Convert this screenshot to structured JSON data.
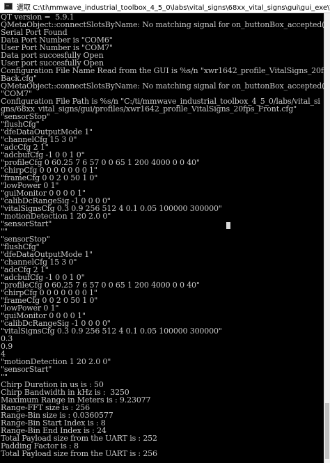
{
  "window": {
    "title": "選取 C:\\ti\\mmwave_industrial_toolbox_4_5_0\\labs\\vital_signs\\68xx_vital_signs\\gui\\gui_exe\\V..."
  },
  "console": {
    "lines": [
      "QT version =  5.9.1",
      "QMetaObject::connectSlotsByName: No matching signal for on_buttonBox_accepted()",
      "Serial Port Found",
      "Data Port Number is \"COM6\"",
      "User Port Number is \"COM7\"",
      "Data port succesfully Open",
      "User port succesfully Open",
      "Configuration File Name Read from the GUI is %s/n \"xwr1642_profile_VitalSigns_20fps_",
      "Back.cfg\"",
      "QMetaObject::connectSlotsByName: No matching signal for on_buttonBox_accepted()",
      "\"COM7\"",
      "Configuration File Path is %s/n \"C:/ti/mmwave_industrial_toolbox_4_5_0/labs/vital_si",
      "gns/68xx_vital_signs/gui/profiles/xwr1642_profile_VitalSigns_20fps_Front.cfg\"",
      "\"sensorStop\"",
      "\"flushCfg\"",
      "\"dfeDataOutputMode 1\"",
      "\"channelCfg 15 3 0\"",
      "\"adcCfg 2 1\"",
      "\"adcbufCfg -1 0 0 1 0\"",
      "\"profileCfg 0 60.25 7 6 57 0 0 65 1 200 4000 0 0 40\"",
      "\"chirpCfg 0 0 0 0 0 0 0 1\"",
      "\"frameCfg 0 0 2 0 50 1 0\"",
      "\"lowPower 0 1\"",
      "\"guiMonitor 0 0 0 0 1\"",
      "\"calibDcRangeSig -1 0 0 0 0\"",
      "\"vitalSignsCfg 0.3 0.9 256 512 4 0.1 0.05 100000 300000\"",
      "\"motionDetection 1 20 2.0 0\"",
      "\"sensorStart\"",
      "\"\"",
      "\"sensorStop\"",
      "\"flushCfg\"",
      "\"dfeDataOutputMode 1\"",
      "\"channelCfg 15 3 0\"",
      "\"adcCfg 2 1\"",
      "\"adcbufCfg -1 0 0 1 0\"",
      "\"profileCfg 0 60.25 7 6 57 0 0 65 1 200 4000 0 0 40\"",
      "\"chirpCfg 0 0 0 0 0 0 0 1\"",
      "\"frameCfg 0 0 2 0 50 1 0\"",
      "\"lowPower 0 1\"",
      "\"guiMonitor 0 0 0 0 1\"",
      "\"calibDcRangeSig -1 0 0 0 0\"",
      "\"vitalSignsCfg 0.3 0.9 256 512 4 0.1 0.05 100000 300000\"",
      "0.3",
      "0.9",
      "4",
      "\"motionDetection 1 20 2.0 0\"",
      "\"sensorStart\"",
      "\"\"",
      "Chirp Duration in us is : 50",
      "Chirp Bandwidth in kHz is :  3250",
      "Maximum Range in Meters is : 9.23077",
      "Range-FFT size is : 256",
      "Range-Bin size is : 0.0360577",
      "Range-Bin Start Index is : 8",
      "Range-Bin End Index is : 24",
      "Total Payload size from the UART is : 252",
      "Padding Factor is : 8",
      "Total Payload size from the UART is : 256"
    ]
  }
}
